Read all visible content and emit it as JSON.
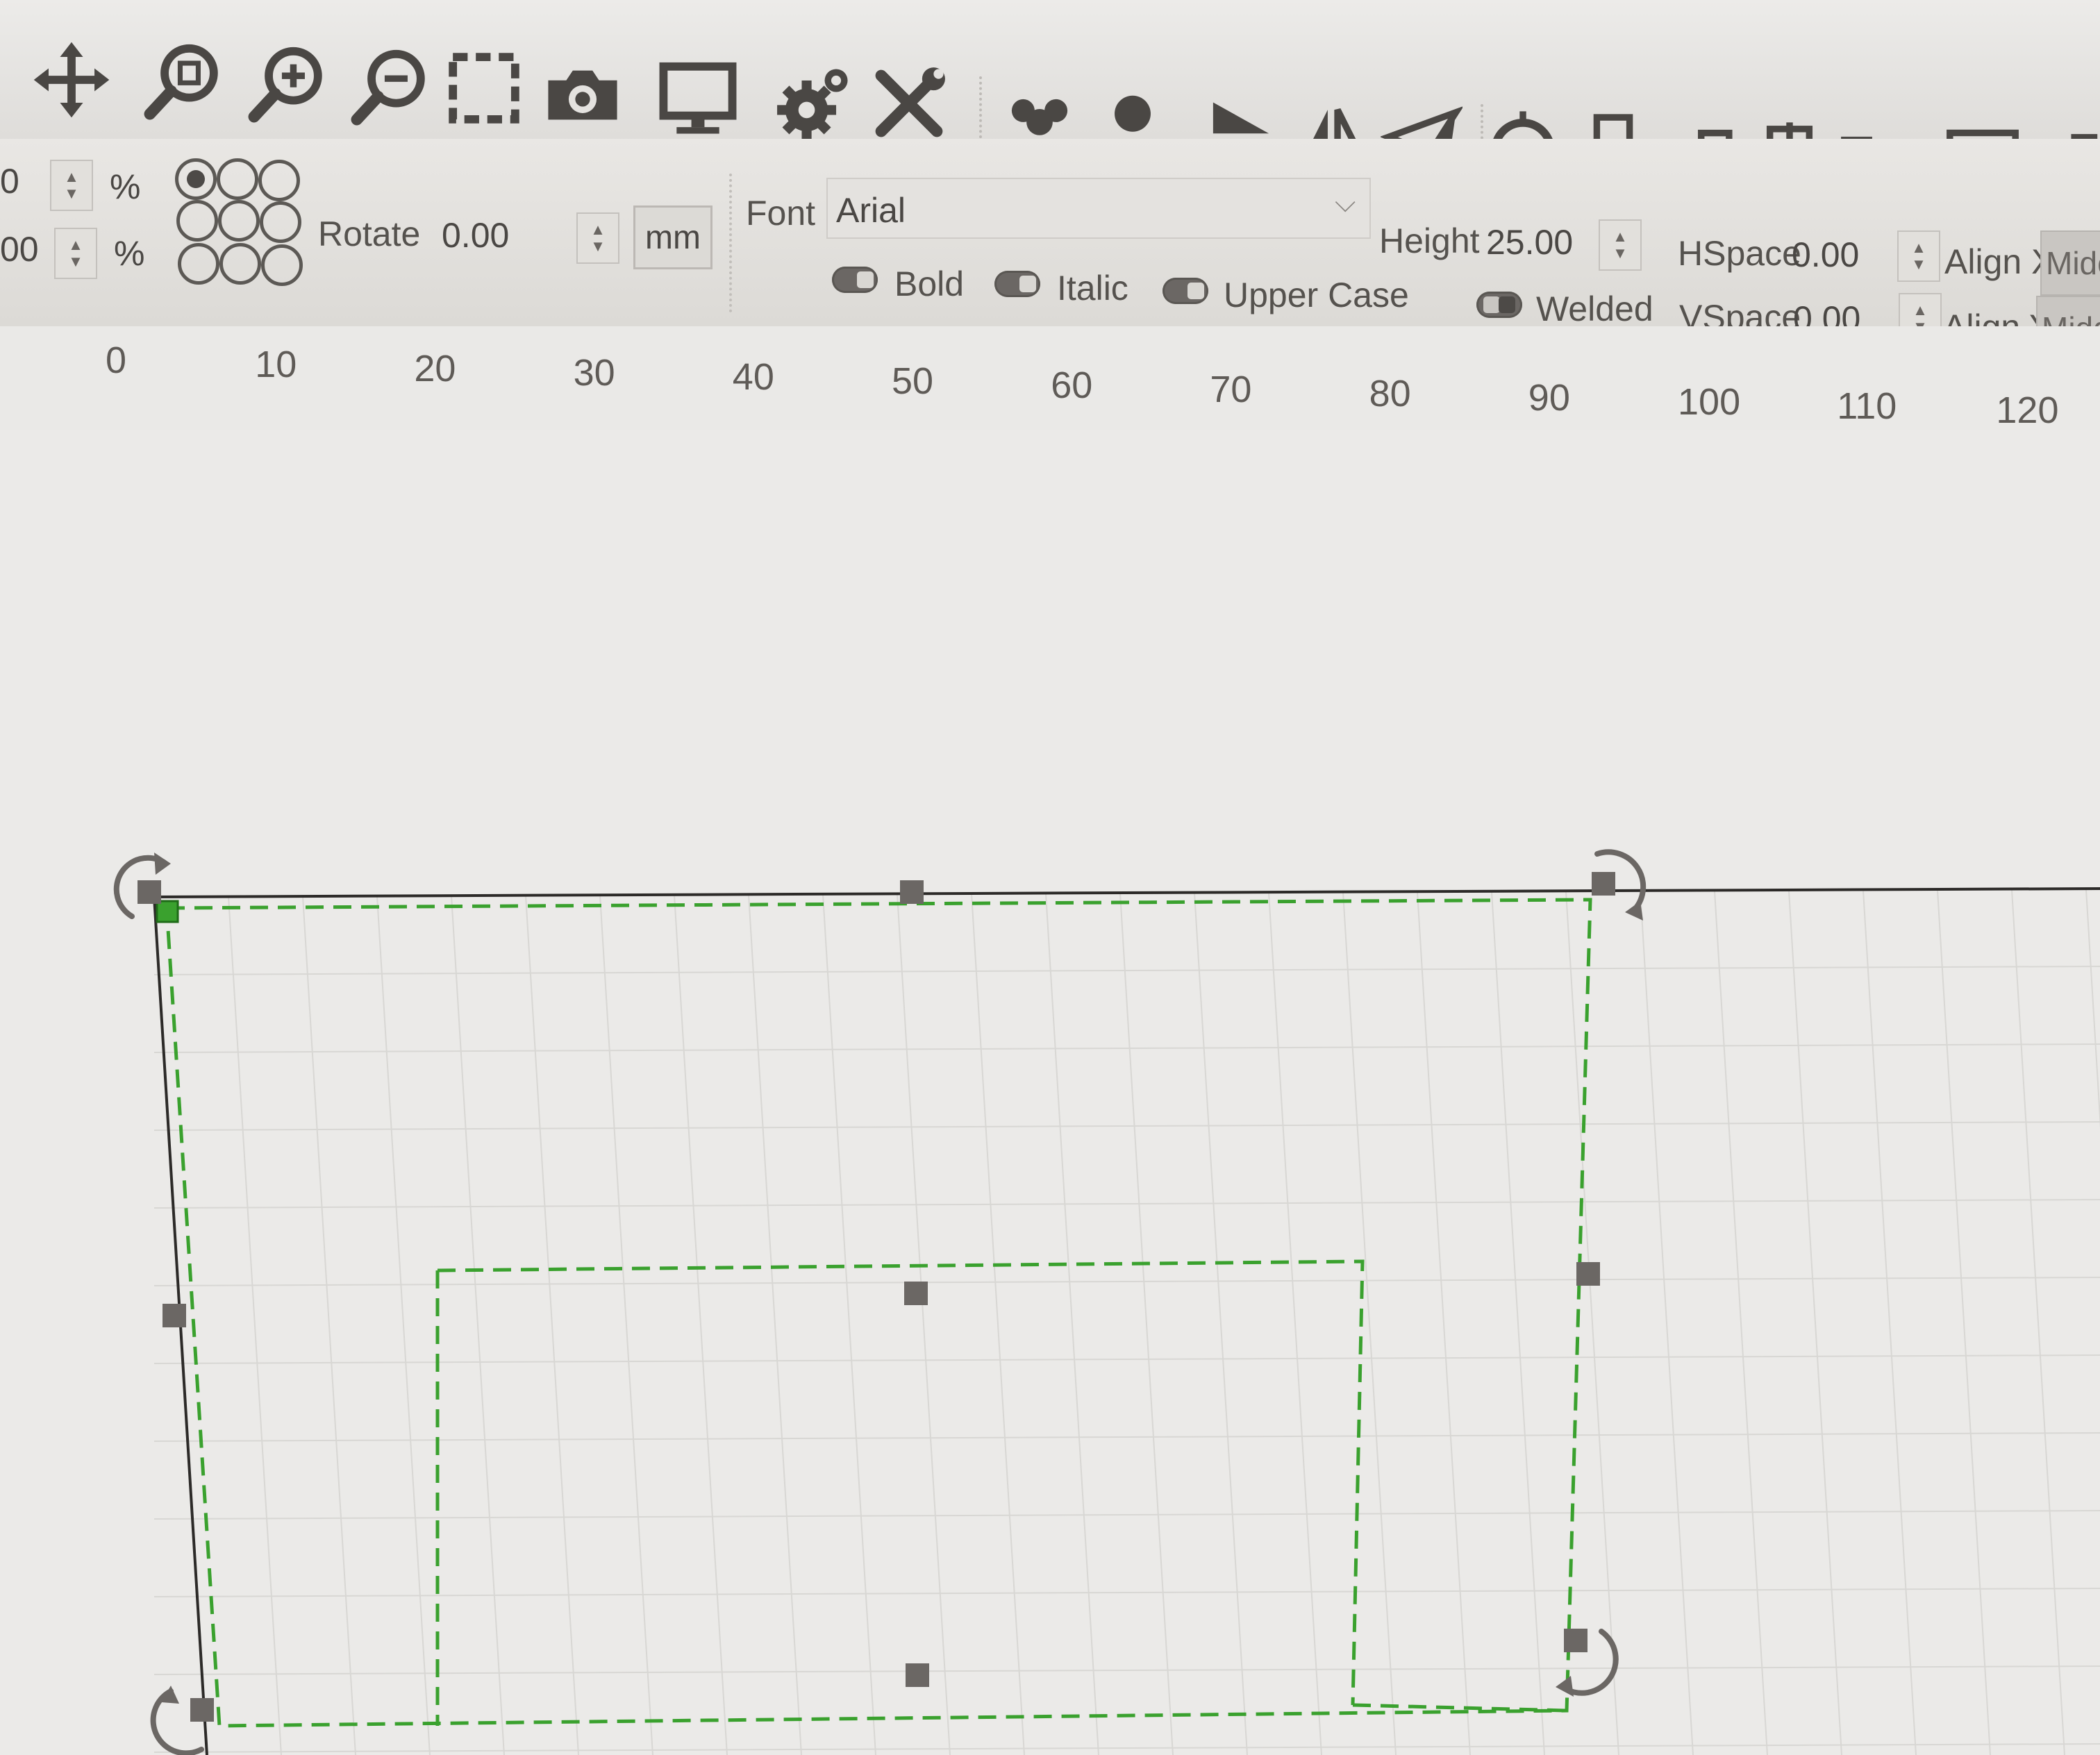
{
  "toolbar": {
    "icons": [
      "move-icon",
      "zoom-page-icon",
      "zoom-in-icon",
      "zoom-out-icon",
      "select-frame-icon",
      "camera-icon",
      "monitor-icon",
      "settings-icon",
      "tools-icon",
      "group-icon",
      "ungroup-icon",
      "mirror-horizontal-icon",
      "mirror-vertical-icon",
      "rotate-mirror-icon",
      "target-icon",
      "align-left-icon",
      "align-top-icon",
      "align-center-h-icon",
      "align-center-v-icon",
      "distribute-h-icon",
      "distribute-v-icon"
    ]
  },
  "propbar": {
    "scale_x_value": "0",
    "scale_y_value": "00",
    "percent_x": "%",
    "percent_y": "%",
    "rotate_label": "Rotate",
    "rotate_value": "0.00",
    "unit": "mm",
    "font_label": "Font",
    "font_value": "Arial",
    "height_label": "Height",
    "height_value": "25.00",
    "hspace_label": "HSpace",
    "hspace_value": "0.00",
    "vspace_label": "VSpace",
    "vspace_value": "0.00",
    "align_x_label": "Align X",
    "align_x_value": "Midc",
    "align_y_label": "Align Y",
    "align_y_value": "Midd",
    "bold_label": "Bold",
    "italic_label": "Italic",
    "upper_case_label": "Upper Case",
    "welded_label": "Welded"
  },
  "ruler": {
    "ticks": [
      "0",
      "10",
      "20",
      "30",
      "40",
      "50",
      "60",
      "70",
      "80",
      "90",
      "100",
      "110",
      "120"
    ]
  },
  "colors": {
    "selection": "#3aa12e",
    "grid": "#d8d7d4",
    "handle": "#6b6764"
  }
}
